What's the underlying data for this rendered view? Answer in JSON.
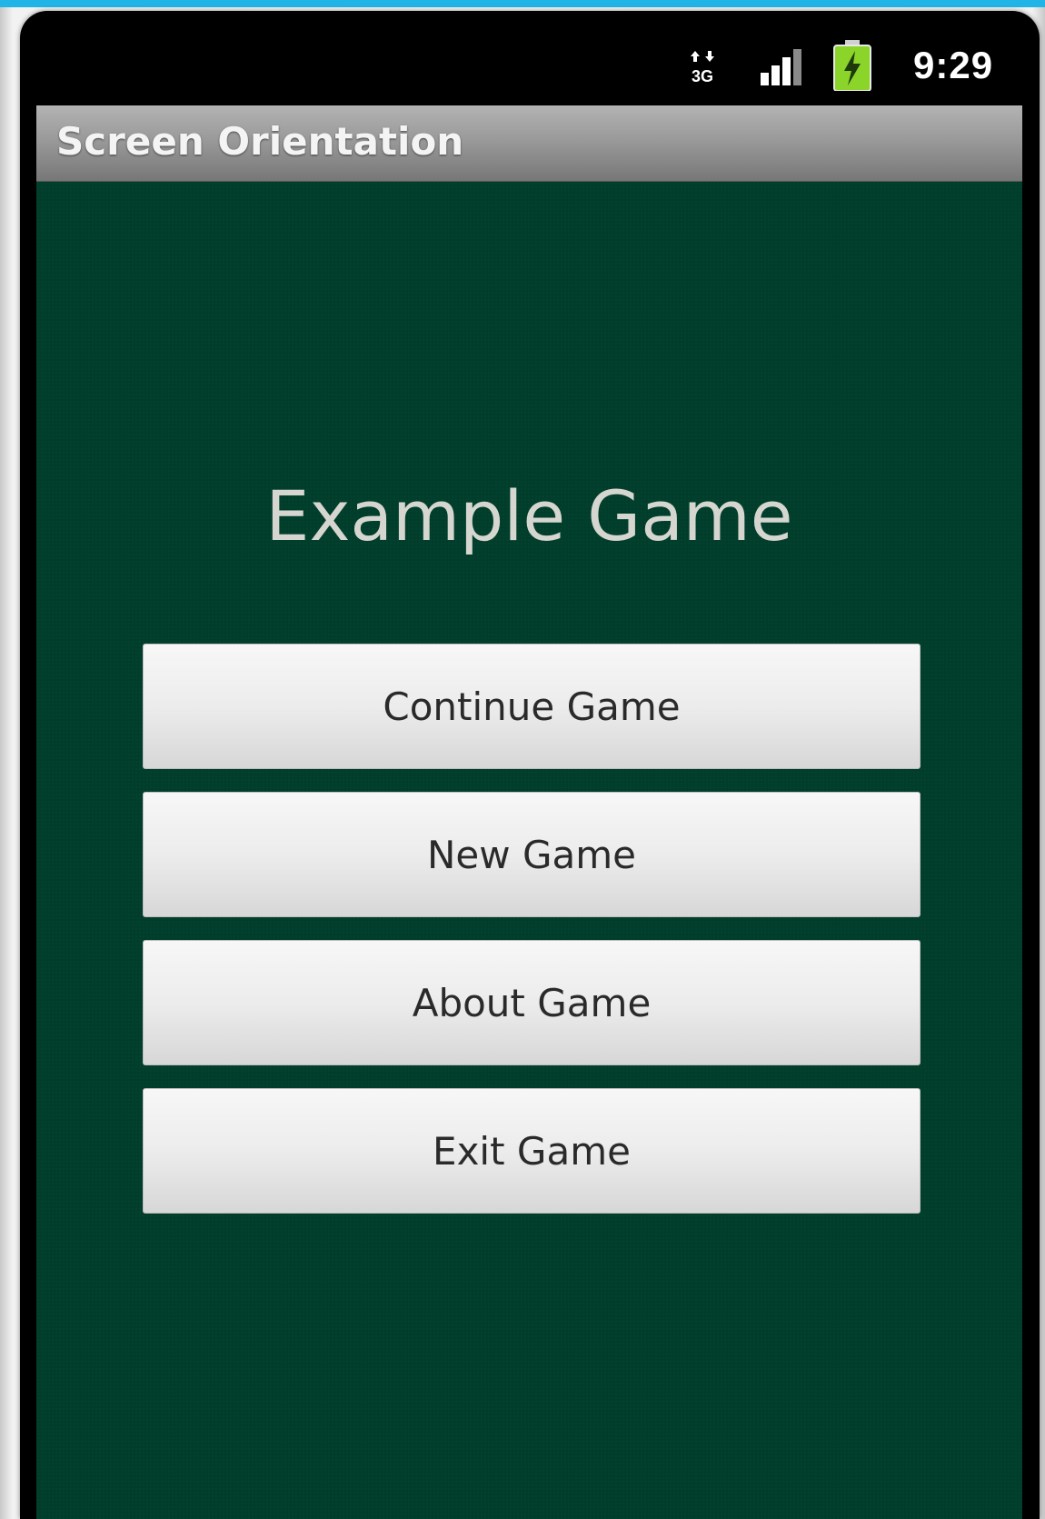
{
  "status_bar": {
    "network_icon": "network-3g-icon",
    "network_label": "3G",
    "signal_icon": "signal-strength-icon",
    "battery_icon": "battery-charging-icon",
    "time": "9:29",
    "colors": {
      "battery": "#8bd42a",
      "text": "#ffffff"
    }
  },
  "app": {
    "title": "Screen Orientation"
  },
  "main": {
    "game_title": "Example Game",
    "buttons": [
      {
        "label": "Continue Game"
      },
      {
        "label": "New Game"
      },
      {
        "label": "About Game"
      },
      {
        "label": "Exit Game"
      }
    ]
  },
  "colors": {
    "accent_strip": "#22b4e6",
    "background": "#003d2a",
    "title_bar": "#9a9a9a",
    "button": "#ececec"
  }
}
